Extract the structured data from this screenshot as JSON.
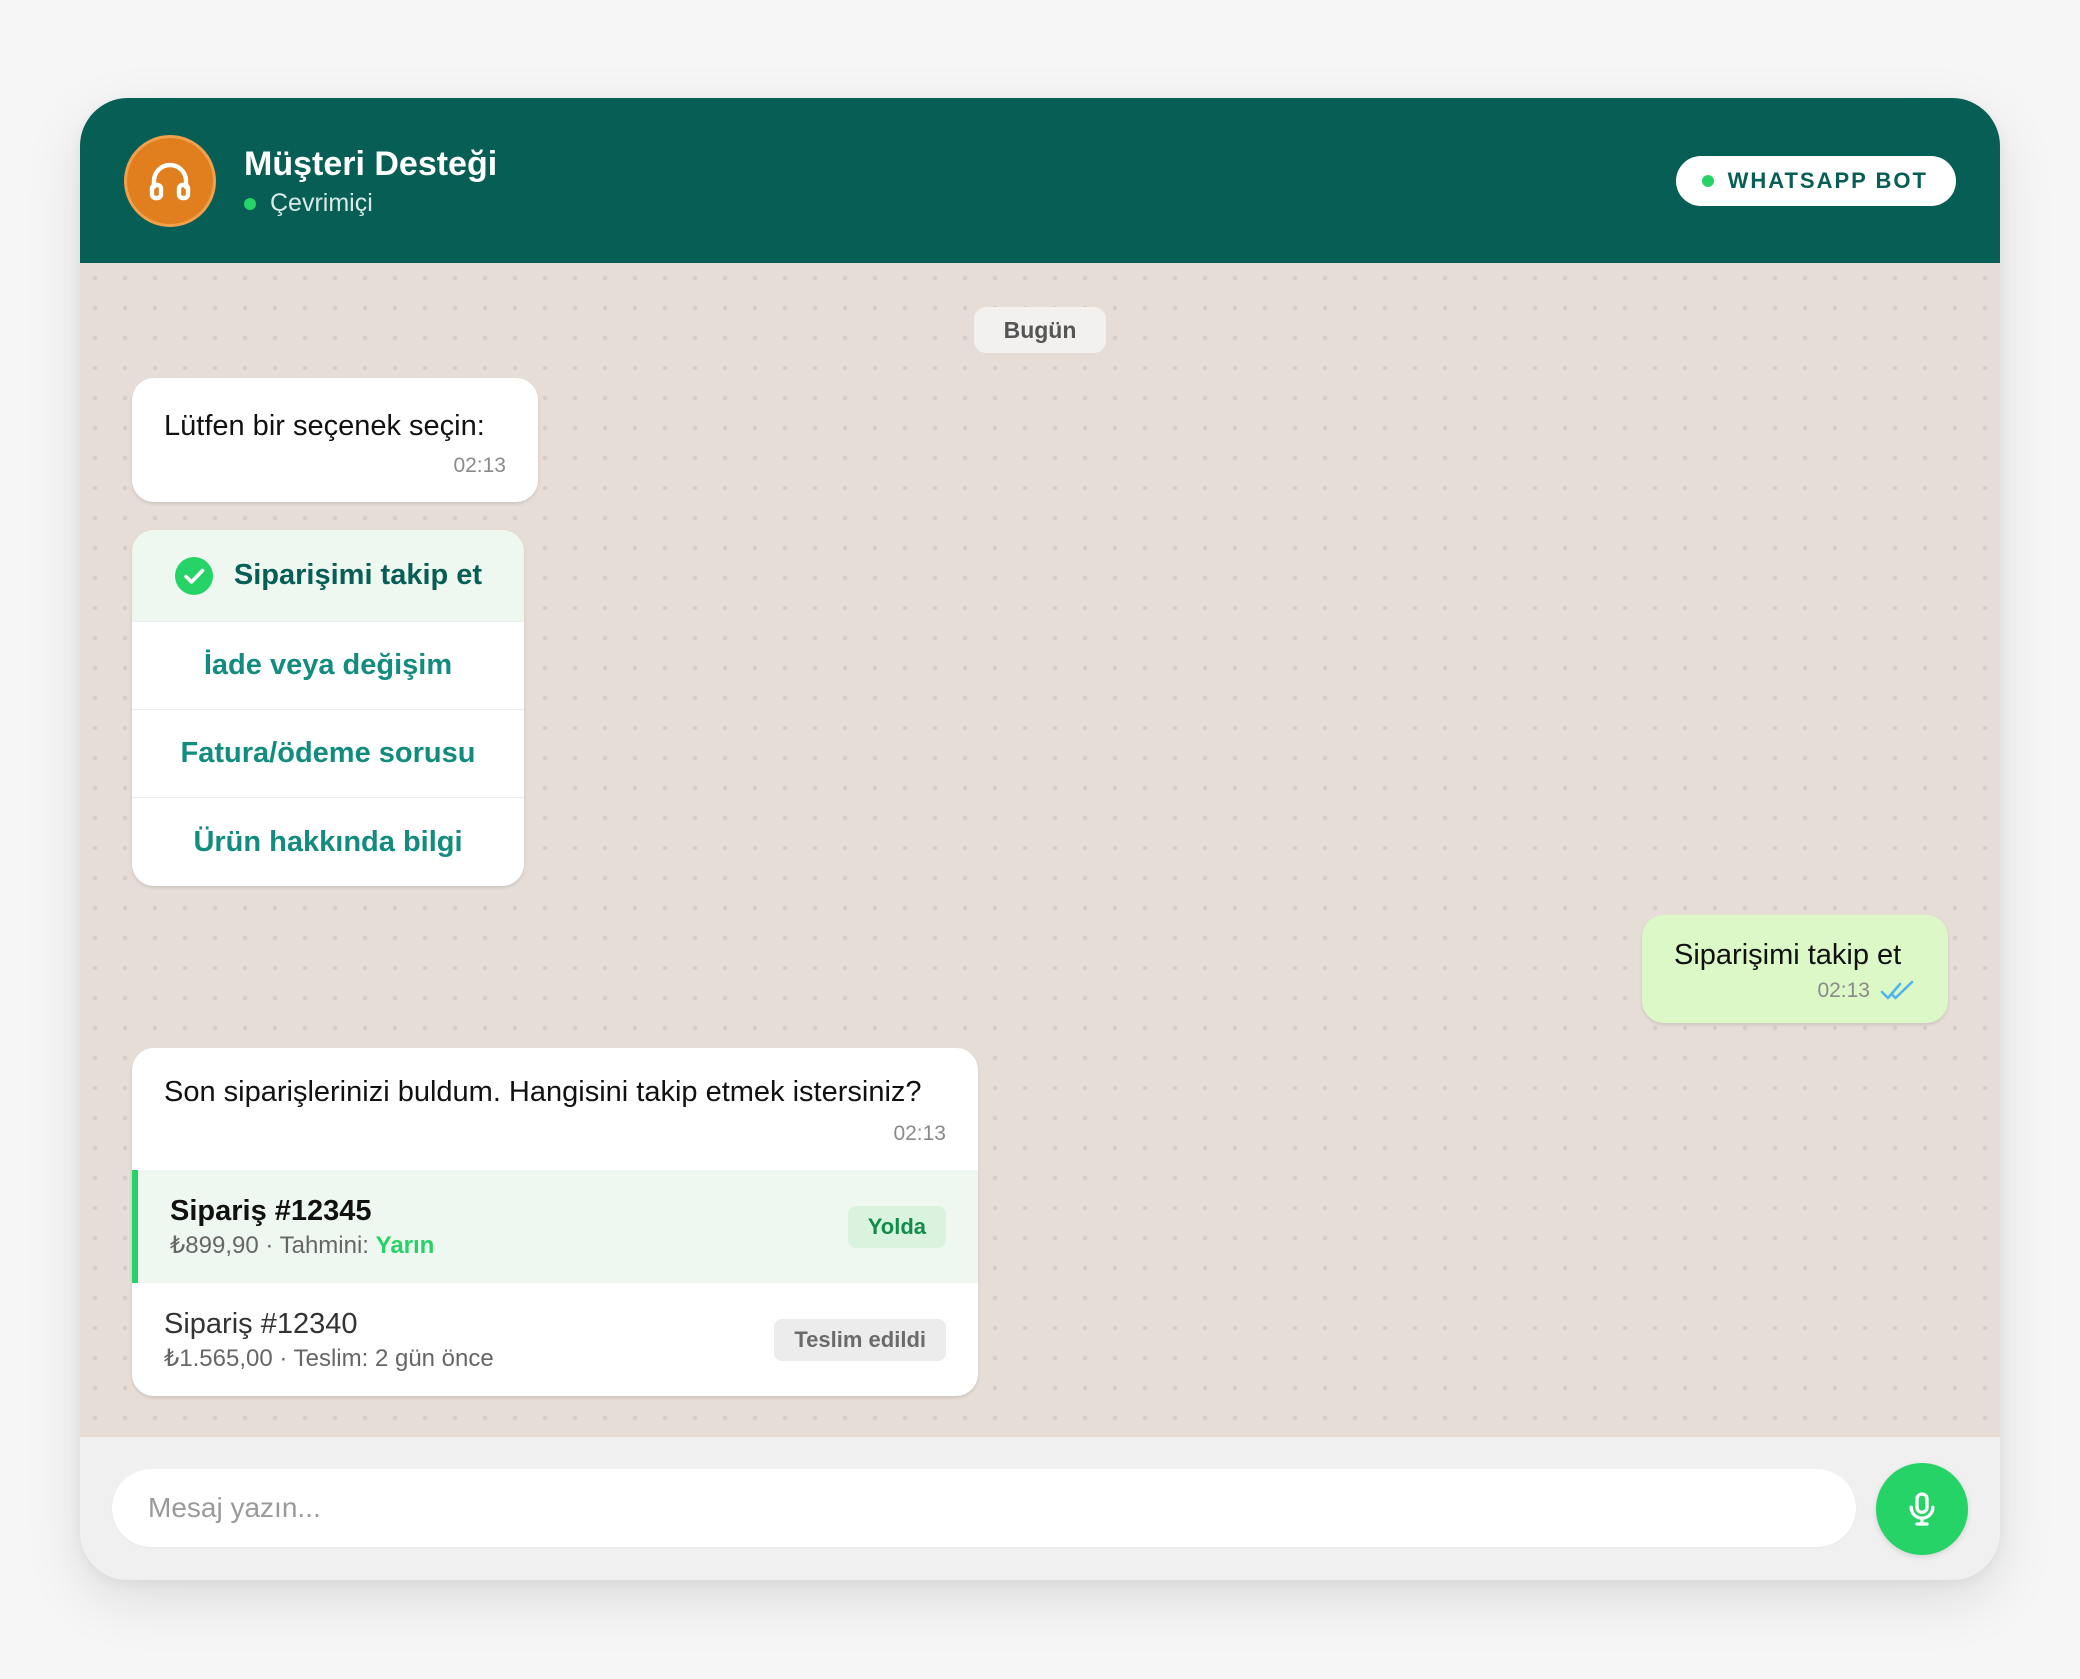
{
  "colors": {
    "header_bg": "#075e54",
    "accent_green": "#25d366",
    "link_teal": "#128c7e",
    "avatar_orange": "#e17f1f",
    "outgoing_bubble": "#dcf8c6",
    "chat_bg": "#e5ddd6"
  },
  "header": {
    "avatar_icon": "headphones-icon",
    "title": "Müşteri Desteği",
    "status": "Çevrimiçi",
    "badge": "WHATSAPP BOT"
  },
  "chat": {
    "date_separator": "Bugün",
    "messages": [
      {
        "text": "Lütfen bir seçenek seçin:",
        "time": "02:13"
      },
      {
        "text": "Siparişimi takip et",
        "time": "02:13",
        "status_icon": "double-check-icon"
      },
      {
        "text": "Son siparişlerinizi buldum. Hangisini takip etmek istersiniz?",
        "time": "02:13"
      }
    ],
    "options": [
      {
        "label": "Siparişimi takip et",
        "selected": true
      },
      {
        "label": "İade veya değişim"
      },
      {
        "label": "Fatura/ödeme sorusu"
      },
      {
        "label": "Ürün hakkında bilgi"
      }
    ],
    "orders": [
      {
        "title": "Sipariş #12345",
        "price": "₺899,90",
        "eta_label": "Tahmini:",
        "eta_value": "Yarın",
        "status": "Yolda"
      },
      {
        "title": "Sipariş #12340",
        "price": "₺1.565,00",
        "delivery": "Teslim: 2 gün önce",
        "status": "Teslim edildi"
      }
    ]
  },
  "composer": {
    "placeholder": "Mesaj yazın...",
    "mic_icon": "microphone-icon"
  }
}
